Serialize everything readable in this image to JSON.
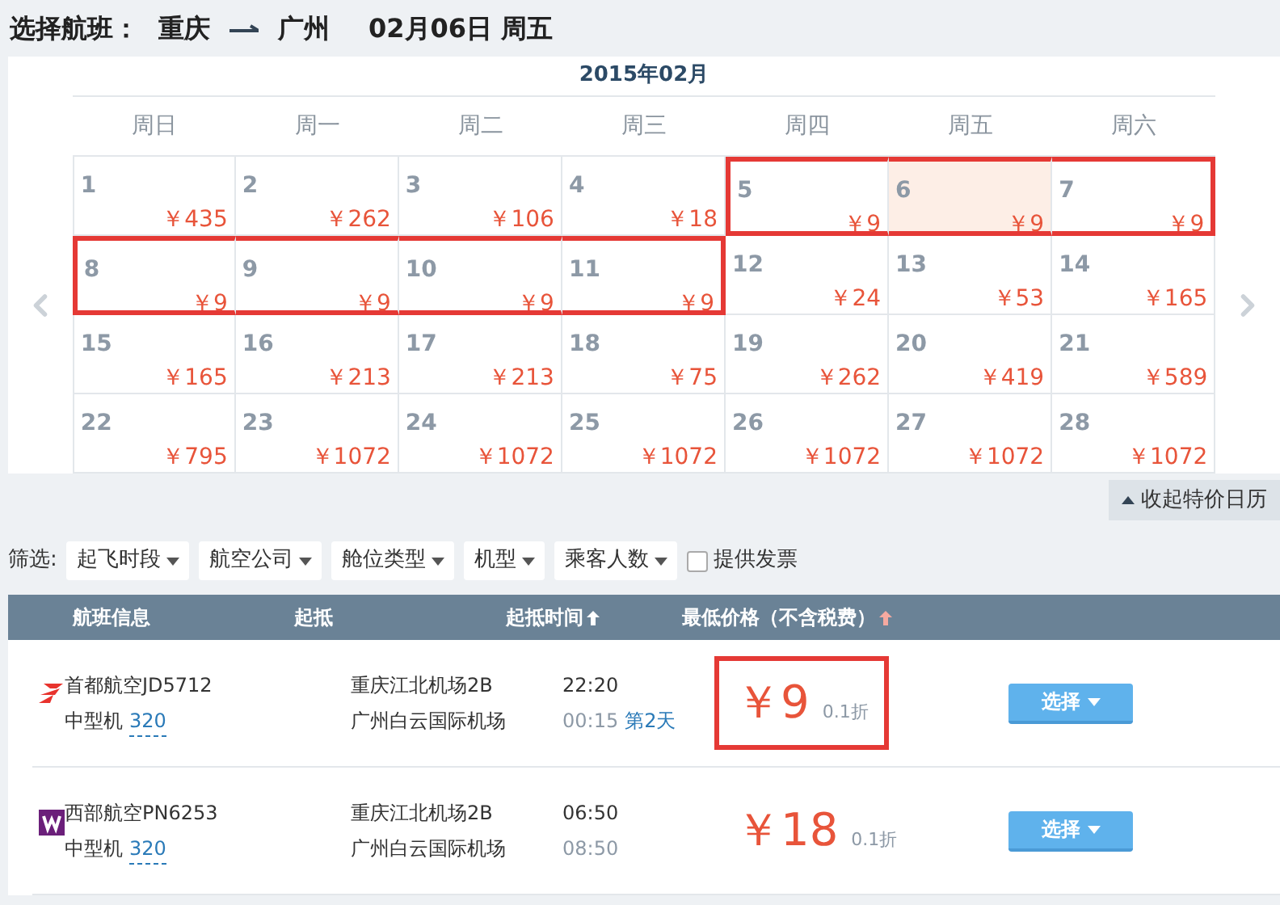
{
  "heading": {
    "label": "选择航班：",
    "from": "重庆",
    "to": "广州",
    "date": "02月06日 周五"
  },
  "calendar": {
    "month": "2015年02月",
    "weekdays": [
      "周日",
      "周一",
      "周二",
      "周三",
      "周四",
      "周五",
      "周六"
    ],
    "weeks": [
      [
        {
          "day": "1",
          "price": "￥435",
          "selected": false,
          "marked": false
        },
        {
          "day": "2",
          "price": "￥262",
          "selected": false,
          "marked": false
        },
        {
          "day": "3",
          "price": "￥106",
          "selected": false,
          "marked": false
        },
        {
          "day": "4",
          "price": "￥18",
          "selected": false,
          "marked": false
        },
        {
          "day": "5",
          "price": "￥9",
          "selected": false,
          "marked": true
        },
        {
          "day": "6",
          "price": "￥9",
          "selected": true,
          "marked": true
        },
        {
          "day": "7",
          "price": "￥9",
          "selected": false,
          "marked": true
        }
      ],
      [
        {
          "day": "8",
          "price": "￥9",
          "selected": false,
          "marked": true
        },
        {
          "day": "9",
          "price": "￥9",
          "selected": false,
          "marked": true
        },
        {
          "day": "10",
          "price": "￥9",
          "selected": false,
          "marked": true
        },
        {
          "day": "11",
          "price": "￥9",
          "selected": false,
          "marked": true
        },
        {
          "day": "12",
          "price": "￥24",
          "selected": false,
          "marked": false
        },
        {
          "day": "13",
          "price": "￥53",
          "selected": false,
          "marked": false
        },
        {
          "day": "14",
          "price": "￥165",
          "selected": false,
          "marked": false
        }
      ],
      [
        {
          "day": "15",
          "price": "￥165",
          "selected": false,
          "marked": false
        },
        {
          "day": "16",
          "price": "￥213",
          "selected": false,
          "marked": false
        },
        {
          "day": "17",
          "price": "￥213",
          "selected": false,
          "marked": false
        },
        {
          "day": "18",
          "price": "￥75",
          "selected": false,
          "marked": false
        },
        {
          "day": "19",
          "price": "￥262",
          "selected": false,
          "marked": false
        },
        {
          "day": "20",
          "price": "￥419",
          "selected": false,
          "marked": false
        },
        {
          "day": "21",
          "price": "￥589",
          "selected": false,
          "marked": false
        }
      ],
      [
        {
          "day": "22",
          "price": "￥795",
          "selected": false,
          "marked": false
        },
        {
          "day": "23",
          "price": "￥1072",
          "selected": false,
          "marked": false
        },
        {
          "day": "24",
          "price": "￥1072",
          "selected": false,
          "marked": false
        },
        {
          "day": "25",
          "price": "￥1072",
          "selected": false,
          "marked": false
        },
        {
          "day": "26",
          "price": "￥1072",
          "selected": false,
          "marked": false
        },
        {
          "day": "27",
          "price": "￥1072",
          "selected": false,
          "marked": false
        },
        {
          "day": "28",
          "price": "￥1072",
          "selected": false,
          "marked": false
        }
      ]
    ]
  },
  "collapse_button": "收起特价日历",
  "filter": {
    "label": "筛选:",
    "dropdowns": [
      "起飞时段",
      "航空公司",
      "舱位类型",
      "机型",
      "乘客人数"
    ],
    "checkbox": {
      "label": "提供发票",
      "checked": false
    }
  },
  "table": {
    "columns": [
      {
        "label": "航班信息",
        "kind": "plain"
      },
      {
        "label": "起抵",
        "kind": "plain"
      },
      {
        "label": "起抵时间",
        "kind": "sortable"
      },
      {
        "label": "最低价格（不含税费）",
        "kind": "sorted"
      }
    ],
    "rows": [
      {
        "kind": "swoosh",
        "airline": "首都航空JD5712",
        "aircraft": "中型机",
        "model": "320",
        "dep_airport": "重庆江北机场2B",
        "arr_airport": "广州白云国际机场",
        "dep_time": "22:20",
        "arr_time": "00:15",
        "next_day": "第2天",
        "price": "￥9",
        "discount": "0.1折",
        "marked": true,
        "button": "选择"
      },
      {
        "kind": "w",
        "airline": "西部航空PN6253",
        "aircraft": "中型机",
        "model": "320",
        "dep_airport": "重庆江北机场2B",
        "arr_airport": "广州白云国际机场",
        "dep_time": "06:50",
        "arr_time": "08:50",
        "price": "￥18",
        "discount": "0.1折",
        "marked": false,
        "button": "选择"
      }
    ]
  }
}
